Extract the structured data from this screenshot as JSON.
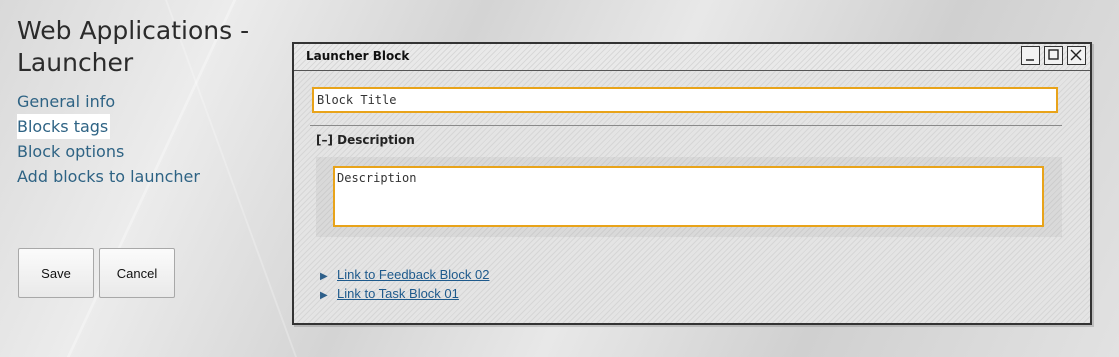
{
  "page": {
    "title": "Web Applications - Launcher"
  },
  "nav": {
    "items": [
      {
        "label": "General info",
        "active": false
      },
      {
        "label": "Blocks tags",
        "active": true
      },
      {
        "label": "Block options",
        "active": false
      },
      {
        "label": "Add blocks to launcher",
        "active": false
      }
    ]
  },
  "actions": {
    "save_label": "Save",
    "cancel_label": "Cancel"
  },
  "window": {
    "title": "Launcher Block",
    "controls": [
      "minimize-icon",
      "maximize-icon",
      "close-icon"
    ],
    "block_title_value": "Block Title",
    "section_label": "[–] Description",
    "description_value": "Description",
    "links": [
      {
        "arrow": "▶",
        "label": "Link to Feedback Block 02"
      },
      {
        "arrow": "▶",
        "label": "Link to Task Block 01"
      }
    ]
  },
  "colors": {
    "accent_border": "#e8a31a",
    "link": "#1e5a8c",
    "nav_text": "#2e6384"
  }
}
